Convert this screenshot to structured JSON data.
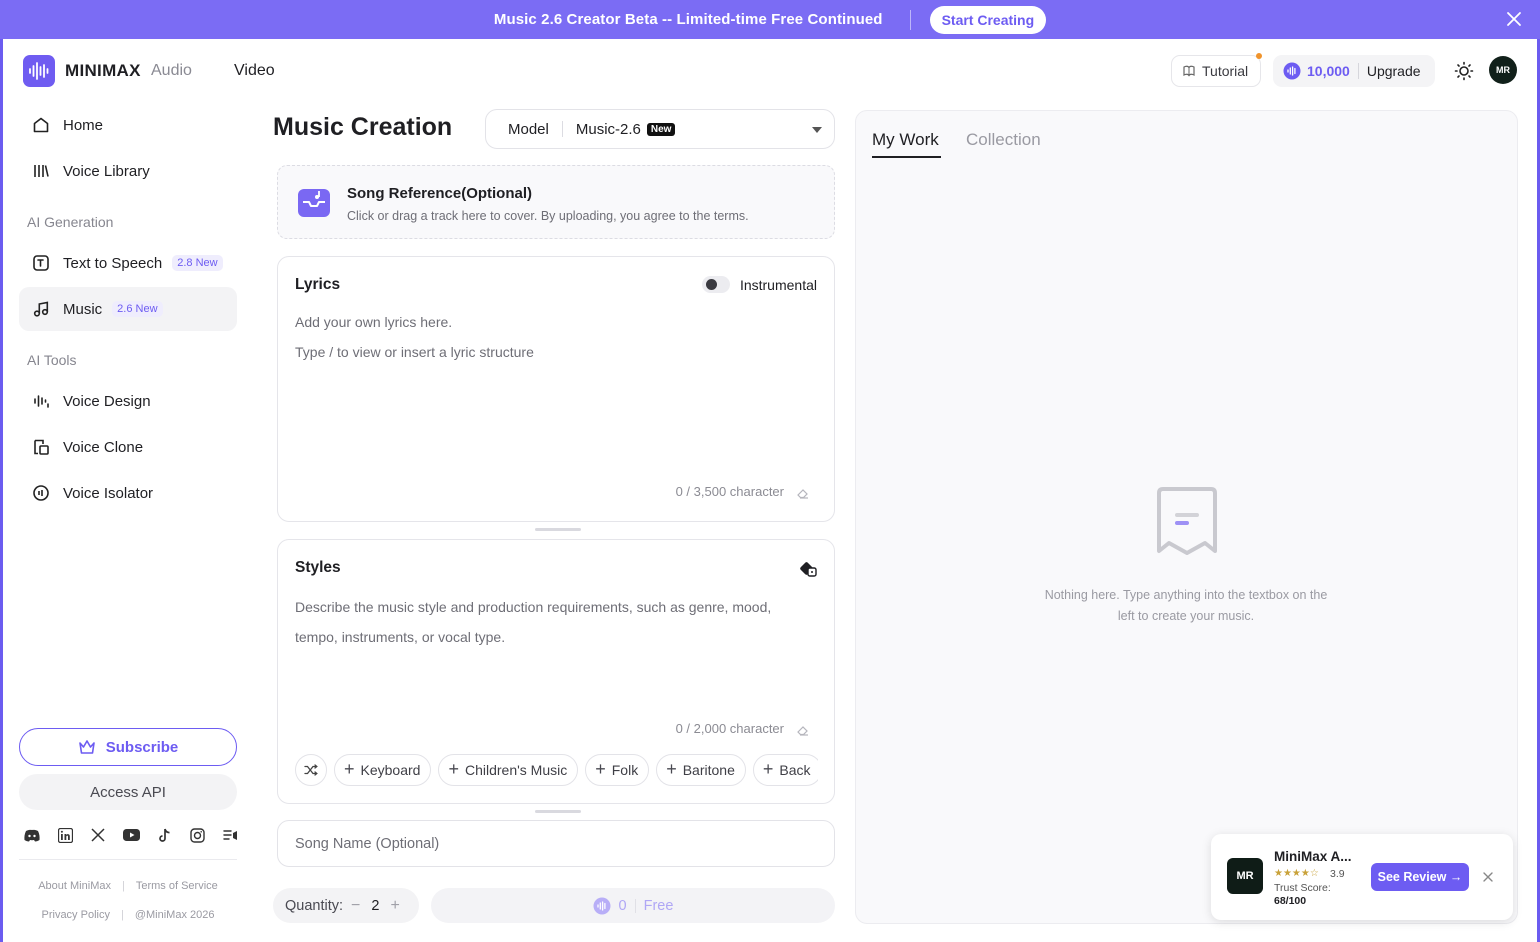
{
  "banner": {
    "text": "Music 2.6 Creator Beta -- Limited-time Free Continued",
    "button": "Start Creating"
  },
  "topbar": {
    "logo": "MINIMAX",
    "product": "Audio",
    "nav_video": "Video",
    "tutorial": "Tutorial",
    "credits": "10,000",
    "upgrade": "Upgrade",
    "avatar": "MR"
  },
  "sidebar": {
    "home": "Home",
    "voice_library": "Voice Library",
    "group_ai_generation": "AI Generation",
    "text_to_speech": "Text to Speech",
    "text_to_speech_badge": "2.8 New",
    "music": "Music",
    "music_badge": "2.6 New",
    "group_ai_tools": "AI Tools",
    "voice_design": "Voice Design",
    "voice_clone": "Voice Clone",
    "voice_isolator": "Voice Isolator",
    "subscribe": "Subscribe",
    "access_api": "Access API",
    "about": "About MiniMax",
    "terms": "Terms of Service",
    "privacy": "Privacy Policy",
    "copyright": "@MiniMax 2026"
  },
  "main": {
    "title": "Music Creation",
    "model_label": "Model",
    "model_value": "Music-2.6",
    "model_tag": "New",
    "ref_title": "Song Reference(Optional)",
    "ref_desc": "Click or drag a track here to cover. By uploading, you agree to the terms.",
    "lyrics_title": "Lyrics",
    "instrumental": "Instrumental",
    "lyrics_placeholder_1": "Add your own lyrics here.",
    "lyrics_placeholder_2": "Type / to view or insert a lyric structure",
    "lyrics_counter": "0 / 3,500 character",
    "styles_title": "Styles",
    "styles_placeholder": "Describe the music style and production requirements, such as genre, mood, tempo, instruments, or vocal type.",
    "styles_counter": "0 / 2,000 character",
    "chips": [
      "Keyboard",
      "Children's Music",
      "Folk",
      "Baritone",
      "Back"
    ],
    "song_name_placeholder": "Song Name (Optional)",
    "quantity_label": "Quantity:",
    "quantity_value": "2",
    "cost": "0",
    "free": "Free"
  },
  "right": {
    "tab_my_work": "My Work",
    "tab_collection": "Collection",
    "empty_text": "Nothing here. Type anything into the textbox on the left to create your music."
  },
  "review": {
    "logo": "MR",
    "name": "MiniMax A...",
    "rating": "3.9",
    "trust_label": "Trust Score:",
    "trust_score": "68/100",
    "button": "See Review →"
  },
  "colors": {
    "accent": "#6d5cf2",
    "banner": "#7b6cf4"
  }
}
